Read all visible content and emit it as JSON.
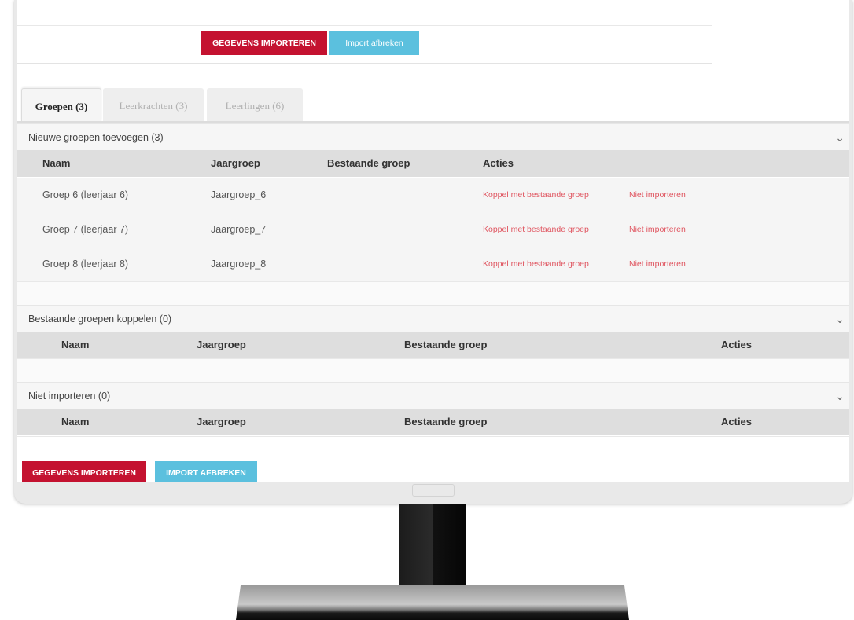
{
  "top_actions": {
    "import_label": "GEGEVENS IMPORTEREN",
    "cancel_label": "Import afbreken"
  },
  "tabs": [
    {
      "label": "Groepen (3)",
      "active": true
    },
    {
      "label": "Leerkrachten (3)",
      "active": false
    },
    {
      "label": "Leerlingen (6)",
      "active": false
    }
  ],
  "sections": {
    "new_groups": {
      "title": "Nieuwe groepen toevoegen (3)",
      "columns": [
        "Naam",
        "Jaargroep",
        "Bestaande groep",
        "Acties"
      ],
      "rows": [
        {
          "naam": "Groep 6 (leerjaar 6)",
          "jaargroep": "Jaargroep_6",
          "bestaande_groep": "",
          "action_link": "Koppel met bestaande groep",
          "action_skip": "Niet importeren"
        },
        {
          "naam": "Groep 7 (leerjaar 7)",
          "jaargroep": "Jaargroep_7",
          "bestaande_groep": "",
          "action_link": "Koppel met bestaande groep",
          "action_skip": "Niet importeren"
        },
        {
          "naam": "Groep 8 (leerjaar 8)",
          "jaargroep": "Jaargroep_8",
          "bestaande_groep": "",
          "action_link": "Koppel met bestaande groep",
          "action_skip": "Niet importeren"
        }
      ]
    },
    "link_groups": {
      "title": "Bestaande groepen koppelen (0)",
      "columns": [
        "Naam",
        "Jaargroep",
        "Bestaande groep",
        "Acties"
      ]
    },
    "skip_groups": {
      "title": "Niet importeren (0)",
      "columns": [
        "Naam",
        "Jaargroep",
        "Bestaande groep",
        "Acties"
      ]
    }
  },
  "bottom_actions": {
    "import_label": "GEGEVENS IMPORTEREN",
    "cancel_label": "IMPORT AFBREKEN"
  },
  "icons": {
    "collapse": "chevron-down-icon"
  },
  "colors": {
    "primary_red": "#c41230",
    "info_blue": "#5bc0de",
    "link_red": "#e05560"
  }
}
